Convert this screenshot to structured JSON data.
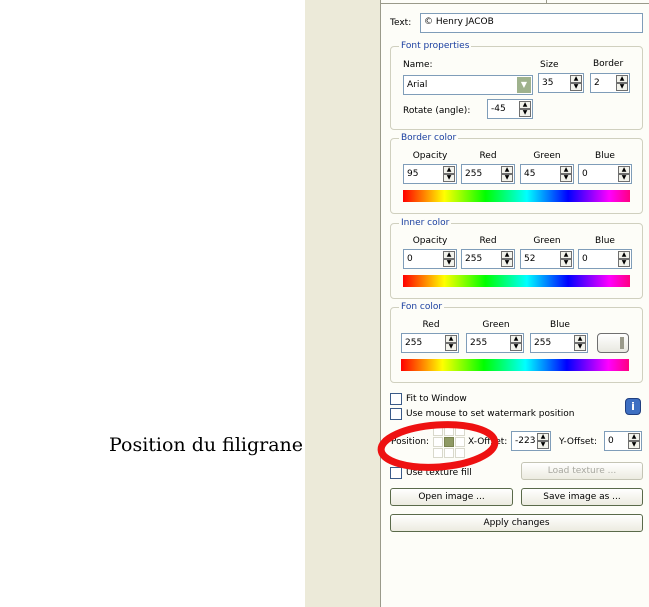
{
  "caption": "Position du filigrane",
  "text_field": {
    "label": "Text:",
    "value": "© Henry JACOB"
  },
  "font_properties": {
    "legend": "Font properties",
    "name_label": "Name:",
    "name_value": "Arial",
    "size_label": "Size",
    "size_value": "35",
    "border_label": "Border",
    "border_value": "2",
    "rotate_label": "Rotate (angle):",
    "rotate_value": "-45"
  },
  "border_color": {
    "legend": "Border color",
    "opacity_label": "Opacity",
    "opacity": "95",
    "red_label": "Red",
    "red": "255",
    "green_label": "Green",
    "green": "45",
    "blue_label": "Blue",
    "blue": "0"
  },
  "inner_color": {
    "legend": "Inner color",
    "opacity_label": "Opacity",
    "opacity": "0",
    "red_label": "Red",
    "red": "255",
    "green_label": "Green",
    "green": "52",
    "blue_label": "Blue",
    "blue": "0"
  },
  "fon_color": {
    "legend": "Fon color",
    "red_label": "Red",
    "red": "255",
    "green_label": "Green",
    "green": "255",
    "blue_label": "Blue",
    "blue": "255"
  },
  "options": {
    "fit_to_window": "Fit to Window",
    "use_mouse": "Use mouse to set watermark position",
    "use_texture": "Use texture fill",
    "info_glyph": "i"
  },
  "position": {
    "label": "Position:",
    "x_label": "X-Offset:",
    "x_value": "-223",
    "y_label": "Y-Offset:",
    "y_value": "0",
    "selected_cell": 4
  },
  "buttons": {
    "load_texture": "Load texture ...",
    "open_image": "Open image ...",
    "save_image": "Save image as ...",
    "apply": "Apply changes"
  },
  "colors": {
    "highlight_ellipse": "#ee1111",
    "legend_text": "#1a3fa0",
    "grid_selected": "#8f9a64"
  }
}
